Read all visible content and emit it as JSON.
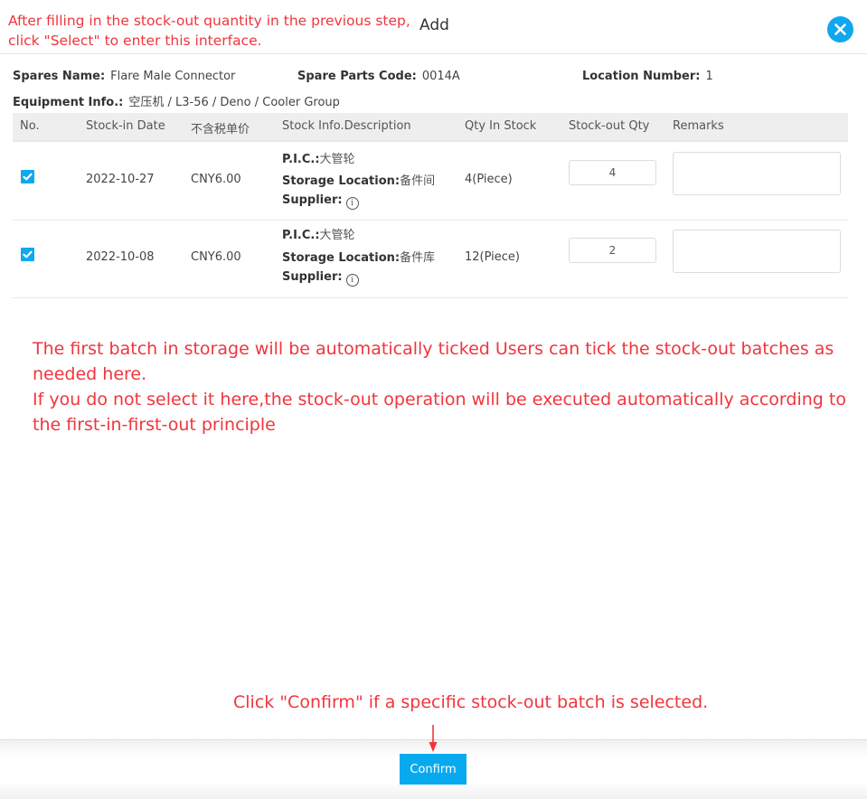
{
  "annotations": {
    "top": [
      "After filling in the stock-out quantity in the previous step,",
      "click \"Select\" to enter this interface."
    ],
    "middle": [
      "The first batch in storage will be automatically ticked  Users can tick the stock-out batches as needed here.",
      "If you do not select it here,the stock-out operation will be executed automatically according to the first-in-first-out principle"
    ],
    "bottom": "Click \"Confirm\" if a specific stock-out batch is selected."
  },
  "dialog": {
    "title": "Add",
    "close_icon": "close-circle-icon"
  },
  "info": {
    "spares_name_label": "Spares Name:",
    "spares_name": "Flare Male Connector",
    "spare_parts_code_label": "Spare Parts Code:",
    "spare_parts_code": "0014A",
    "location_number_label": "Location Number:",
    "location_number": "1",
    "equipment_info_label": "Equipment Info.:",
    "equipment_info": "空压机 / L3-56 / Deno / Cooler Group"
  },
  "table": {
    "columns": [
      "No.",
      "Stock-in Date",
      "不含税单价",
      "Stock Info.Description",
      "Qty In Stock",
      "Stock-out Qty",
      "Remarks"
    ],
    "desc_labels": {
      "pic": "P.I.C.:",
      "storage_location": "Storage Location:",
      "supplier": "Supplier:"
    },
    "rows": [
      {
        "checked": true,
        "stock_in_date": "2022-10-27",
        "unit_price": "CNY6.00",
        "pic": "大管轮",
        "storage_location": "备件间",
        "supplier_icon": "info-circle-icon",
        "qty_in_stock": "4(Piece)",
        "stock_out_qty": "4",
        "remarks": ""
      },
      {
        "checked": true,
        "stock_in_date": "2022-10-08",
        "unit_price": "CNY6.00",
        "pic": "大管轮",
        "storage_location": "备件库",
        "supplier_icon": "info-circle-icon",
        "qty_in_stock": "12(Piece)",
        "stock_out_qty": "2",
        "remarks": ""
      }
    ]
  },
  "footer": {
    "confirm_label": "Confirm"
  },
  "colors": {
    "accent": "#0fa8ef",
    "annotation": "#f0353d"
  }
}
